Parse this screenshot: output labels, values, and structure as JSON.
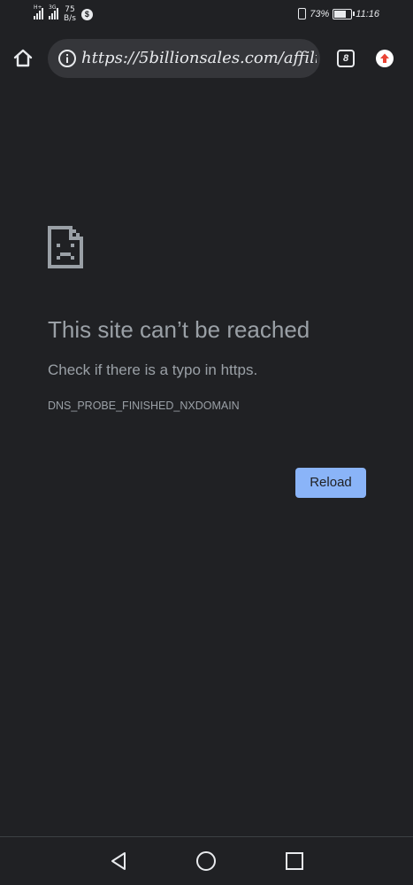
{
  "status_bar": {
    "network_speed_value": "75",
    "network_speed_unit": "B/s",
    "signal_1_tag": "H+",
    "signal_2_tag": "3G",
    "battery_percent": "73%",
    "time": "11:16",
    "battery_level": 0.73
  },
  "toolbar": {
    "url": "https://5billionsales.com/affiliate/...",
    "tab_count": "8",
    "icons": {
      "home": "home-icon",
      "info": "info-icon",
      "tabs": "tab-switcher-icon",
      "update": "update-arrow-icon"
    }
  },
  "error_page": {
    "title": "This site can’t be reached",
    "hint": "Check if there is a typo in https.",
    "error_code": "DNS_PROBE_FINISHED_NXDOMAIN",
    "reload_label": "Reload",
    "icon": "sad-document-icon"
  },
  "nav_bar": {
    "icons": [
      "back-icon",
      "home-circle-icon",
      "recents-icon"
    ]
  },
  "colors": {
    "background": "#202124",
    "omnibox": "#35363a",
    "text_secondary": "#9aa0a6",
    "accent": "#8ab4f8",
    "update_arrow": "#ea4335"
  }
}
